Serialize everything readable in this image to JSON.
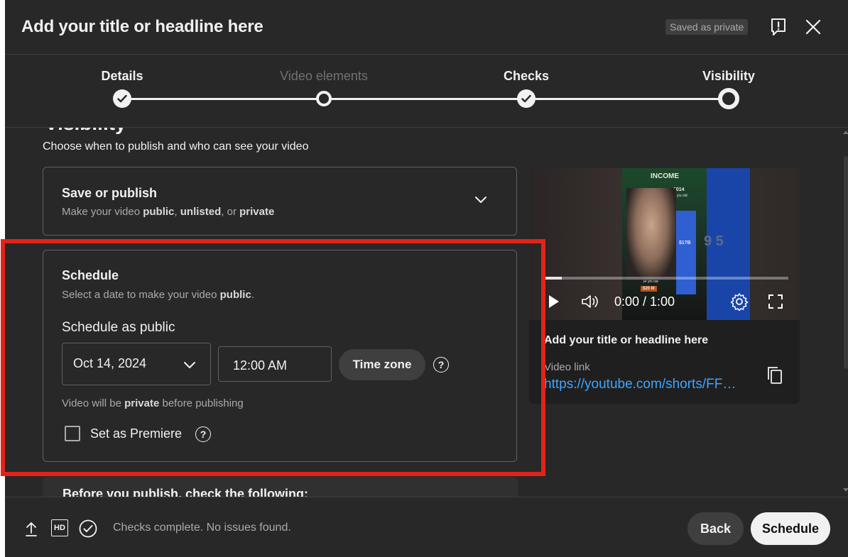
{
  "header": {
    "title": "Add your title or headline here",
    "saved_badge": "Saved as private",
    "feedback_icon": "feedback-icon",
    "close_icon": "close-icon"
  },
  "stepper": {
    "steps": [
      {
        "label": "Details",
        "state": "done"
      },
      {
        "label": "Video elements",
        "state": "skipped"
      },
      {
        "label": "Checks",
        "state": "done"
      },
      {
        "label": "Visibility",
        "state": "current"
      }
    ]
  },
  "visibility": {
    "heading": "Visibility",
    "subtitle": "Choose when to publish and who can see your video"
  },
  "save_publish": {
    "title": "Save or publish",
    "sub_prefix": "Make your video ",
    "opt_public": "public",
    "sep1": ", ",
    "opt_unlisted": "unlisted",
    "sep2": ", or ",
    "opt_private": "private"
  },
  "schedule": {
    "title": "Schedule",
    "sub_prefix": "Select a date to make your video ",
    "sub_bold": "public",
    "sub_suffix": ".",
    "section_label": "Schedule as public",
    "date": "Oct 14, 2024",
    "time": "12:00 AM",
    "timezone_button": "Time zone",
    "note_prefix": "Video will be ",
    "note_bold": "private",
    "note_suffix": " before publishing",
    "premiere_label": "Set as Premiere",
    "premiere_checked": false
  },
  "preview": {
    "thumb_title": "INCOME",
    "thumb_year_top": "2014",
    "thumb_age_top": "49 yrs old",
    "thumb_value": "$17B",
    "thumb_year_bottom": "1999",
    "thumb_age_bottom": "34 yrs old",
    "thumb_money": "$20 M",
    "overlay_digits": "9 5",
    "time": "0:00 / 1:00",
    "progress": 0.08,
    "title": "Add your title or headline here",
    "link_label": "Video link",
    "link": "https://youtube.com/shorts/FFxxxxxxx"
  },
  "peek_text": "Before you publish, check the following:",
  "footer": {
    "status": "Checks complete. No issues found.",
    "back": "Back",
    "schedule": "Schedule"
  },
  "colors": {
    "background": "#282828",
    "accent_link": "#3ea6ff",
    "highlight": "#e2231a"
  }
}
